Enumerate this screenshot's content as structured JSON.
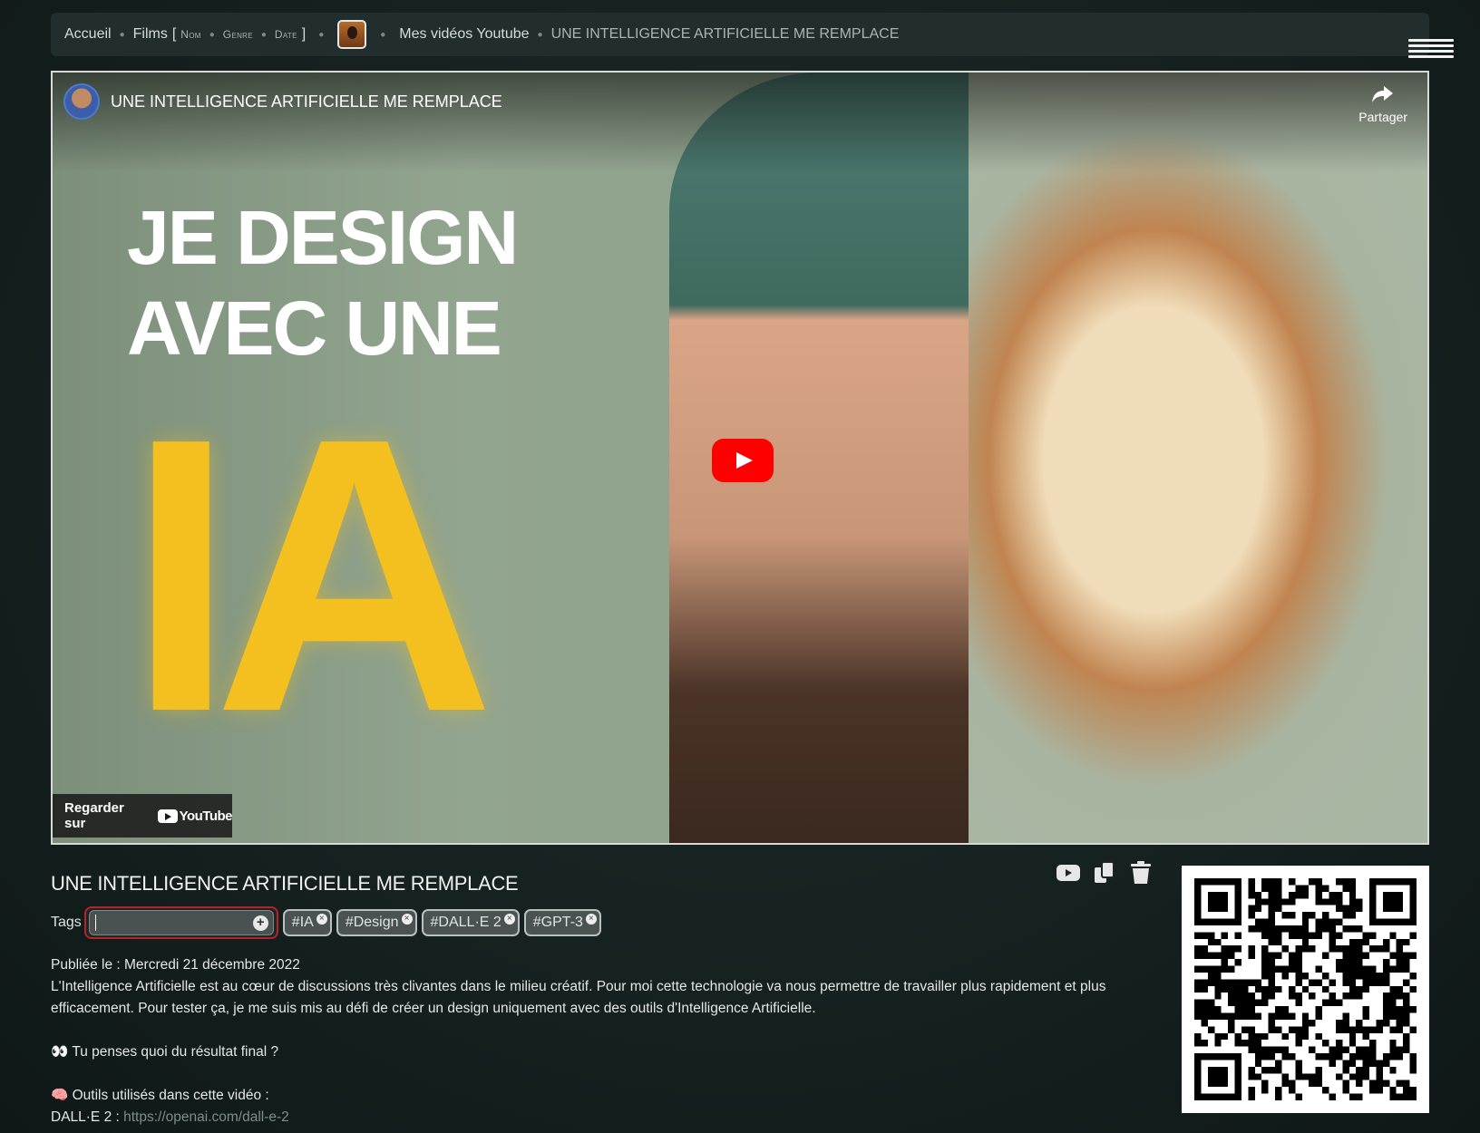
{
  "breadcrumb": {
    "home": "Accueil",
    "films": "Films",
    "open_bracket": "[",
    "sort_name": "Nom",
    "sort_genre": "Genre",
    "sort_date": "Date",
    "close_bracket": "]",
    "channel": "Mes vidéos Youtube",
    "current": "UNE INTELLIGENCE ARTIFICIELLE ME REMPLACE"
  },
  "video": {
    "title": "UNE INTELLIGENCE ARTIFICIELLE ME REMPLACE",
    "share_label": "Partager",
    "thumb_line1": "JE DESIGN",
    "thumb_line2": "AVEC UNE",
    "thumb_big": "IA",
    "watch_on": "Regarder sur",
    "youtube_brand": "YouTube"
  },
  "details": {
    "title": "UNE INTELLIGENCE ARTIFICIELLE ME REMPLACE",
    "tags_label": "Tags",
    "tag_input_value": "",
    "tags": [
      "#IA",
      "#Design",
      "#DALL·E 2",
      "#GPT-3"
    ],
    "published": "Publiée le : Mercredi 21 décembre 2022",
    "description_line1": "L'Intelligence Artificielle est au cœur de discussions très clivantes dans le milieu créatif. Pour moi cette technologie va nous permettre de travailler plus rapidement et plus efficacement. Pour tester ça, je me suis mis au défi de créer un design uniquement avec des outils d'Intelligence Artificielle.",
    "question": "👀 Tu penses quoi du résultat final ?",
    "tools_heading": "🧠 Outils utilisés dans cette vidéo :",
    "dalle_label": "DALL·E 2 :",
    "dalle_link": "https://openai.com/dall-e-2"
  },
  "icons": {
    "menu": "hamburger-icon",
    "share": "share-icon",
    "play": "play-icon",
    "youtube": "youtube-icon",
    "copy": "copy-icon",
    "delete": "trash-icon"
  },
  "colors": {
    "background": "#15201f",
    "topbar": "#222e2d",
    "youtube_red": "#ff0000",
    "thumb_yellow": "#f4c020",
    "input_focus": "#b6242a"
  }
}
